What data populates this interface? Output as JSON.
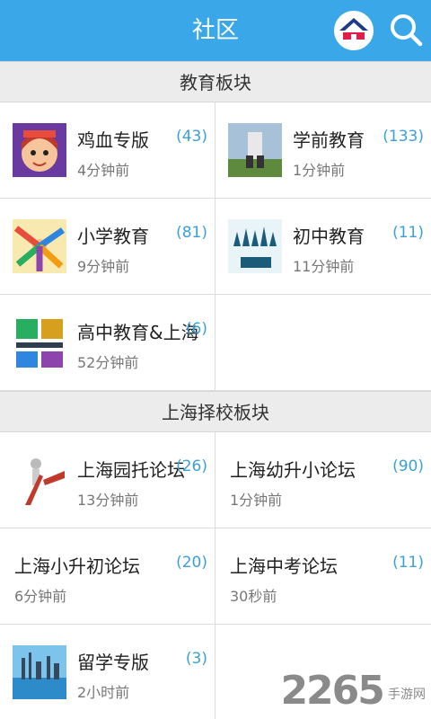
{
  "header": {
    "title": "社区"
  },
  "sections": [
    {
      "title": "教育板块",
      "items": [
        {
          "name": "鸡血专版",
          "count": "(43)",
          "time": "4分钟前"
        },
        {
          "name": "学前教育",
          "count": "(133)",
          "time": "1分钟前"
        },
        {
          "name": "小学教育",
          "count": "(81)",
          "time": "9分钟前"
        },
        {
          "name": "初中教育",
          "count": "(11)",
          "time": "11分钟前"
        },
        {
          "name": "高中教育&上海",
          "count": "(6)",
          "time": "52分钟前"
        }
      ]
    },
    {
      "title": "上海择校板块",
      "items": [
        {
          "name": "上海园托论坛",
          "count": "(26)",
          "time": "13分钟前"
        },
        {
          "name": "上海幼升小论坛",
          "count": "(90)",
          "time": "1分钟前"
        },
        {
          "name": "上海小升初论坛",
          "count": "(20)",
          "time": "6分钟前"
        },
        {
          "name": "上海中考论坛",
          "count": "(11)",
          "time": "30秒前"
        },
        {
          "name": "留学专版",
          "count": "(3)",
          "time": "2小时前"
        }
      ]
    }
  ],
  "watermark": {
    "number": "2265",
    "suffix": "手游网"
  },
  "colors": {
    "accent": "#3aa7e8",
    "count": "#3aa0d8"
  }
}
